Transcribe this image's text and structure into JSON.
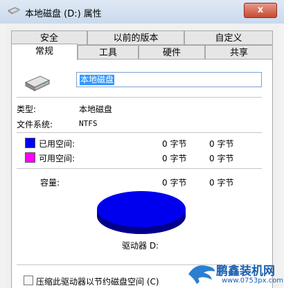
{
  "window": {
    "title": "本地磁盘 (D:) 属性",
    "close_label": "x"
  },
  "tabs_row1": [
    {
      "label": "安全"
    },
    {
      "label": "以前的版本"
    },
    {
      "label": "自定义"
    }
  ],
  "tabs_row2": [
    {
      "label": "常规",
      "active": true
    },
    {
      "label": "工具"
    },
    {
      "label": "硬件"
    },
    {
      "label": "共享"
    }
  ],
  "general": {
    "name_value": "本地磁盘",
    "type_label": "类型:",
    "type_value": "本地磁盘",
    "fs_label": "文件系统:",
    "fs_value": "NTFS",
    "used_label": "已用空间:",
    "used_bytes": "0 字节",
    "used_size": "0 字节",
    "free_label": "可用空间:",
    "free_bytes": "0 字节",
    "free_size": "0 字节",
    "capacity_label": "容量:",
    "capacity_bytes": "0 字节",
    "capacity_size": "0 字节",
    "drive_label": "驱动器 D:",
    "compress_label": "压缩此驱动器以节约磁盘空间 (C)"
  },
  "colors": {
    "used": "#0000ff",
    "free": "#ff00ff",
    "pie_top": "#0000ee",
    "pie_side": "#00008a"
  },
  "watermark": {
    "brand": "鹏鑫装机网",
    "url": "www.0753px.com"
  }
}
